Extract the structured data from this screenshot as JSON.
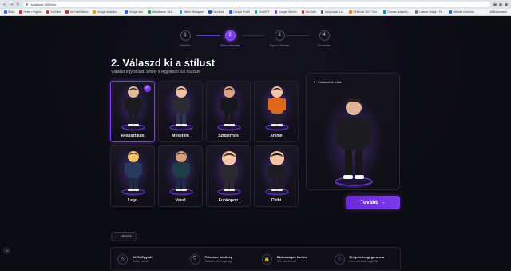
{
  "browser": {
    "url": "localhost:3000/hu",
    "bookmarks": [
      {
        "label": "Sidex",
        "color": "#2563eb"
      },
      {
        "label": "Hetek • Fog hu",
        "color": "#dc2626"
      },
      {
        "label": "YouTube",
        "color": "#dc2626"
      },
      {
        "label": "YouTube Music",
        "color": "#dc2626"
      },
      {
        "label": "Google Analytics ...",
        "color": "#f59e0b"
      },
      {
        "label": "Google Ads",
        "color": "#2563eb"
      },
      {
        "label": "Netsalesum - Kal...",
        "color": "#16a34a"
      },
      {
        "label": "Sitkert Sikkapper",
        "color": "#0ea5e9"
      },
      {
        "label": "Facebook",
        "color": "#1d4ed8"
      },
      {
        "label": "Google Profilt",
        "color": "#2563eb"
      },
      {
        "label": "ChatGPT",
        "color": "#10a37f"
      },
      {
        "label": "Google Gemini",
        "color": "#7c3aed"
      },
      {
        "label": "YouTube",
        "color": "#dc2626"
      },
      {
        "label": "Upsprovas a s...",
        "color": "#4b5563"
      },
      {
        "label": "SEMrush SEO Tool...",
        "color": "#f97316"
      },
      {
        "label": "Domain authority...",
        "color": "#0891b2"
      },
      {
        "label": "Custom Image - Fit...",
        "color": "#6b7280"
      },
      {
        "label": "Website Authority...",
        "color": "#2563eb"
      }
    ],
    "all_bookmarks": "All Bookmarks"
  },
  "steps": [
    {
      "num": "1",
      "label": "Feltöltés",
      "active": false
    },
    {
      "num": "2",
      "label": "Stílus választás",
      "active": true
    },
    {
      "num": "3",
      "label": "Figura előnézet",
      "active": false
    },
    {
      "num": "4",
      "label": "Rendelés",
      "active": false
    }
  ],
  "page": {
    "title": "2. Válaszd ki a stílust",
    "subtitle": "Válassz egy stílust, amely a legjobban illik hozzád!"
  },
  "styles": [
    {
      "name": "Realisztikus",
      "selected": true,
      "skin": "#e0b89a",
      "hair": "#2a1f1a",
      "cloth": "#1b1b1f",
      "pants": "#1b1b1f"
    },
    {
      "name": "Mesefilm",
      "selected": false,
      "skin": "#f0c2a0",
      "hair": "#3b2a20",
      "cloth": "#2b2b33",
      "pants": "#2a3550"
    },
    {
      "name": "Szuperhős",
      "selected": false,
      "skin": "#d9a584",
      "hair": "#1c1c1c",
      "cloth": "#17181c",
      "pants": "#17181c"
    },
    {
      "name": "Anime",
      "selected": false,
      "skin": "#f2c6a4",
      "hair": "#1a1a1a",
      "cloth": "#e0661c",
      "pants": "#1e1e24"
    },
    {
      "name": "Lego",
      "selected": false,
      "skin": "#f2c46b",
      "hair": "#3a2a1e",
      "cloth": "#2a3a5c",
      "pants": "#1f2a44"
    },
    {
      "name": "Voxel",
      "selected": false,
      "skin": "#d8a37c",
      "hair": "#3a2618",
      "cloth": "#1f3c46",
      "pants": "#1d2b4a"
    },
    {
      "name": "Funkopop",
      "selected": false,
      "skin": "#f4c8a8",
      "hair": "#4a3020",
      "cloth": "#2a2a30",
      "pants": "#2a2a30"
    },
    {
      "name": "Chibi",
      "selected": false,
      "skin": "#f0c4a4",
      "hair": "#231a15",
      "cloth": "#1c1c22",
      "pants": "#1c1c22"
    }
  ],
  "preview": {
    "title": "Kiválasztott stílus"
  },
  "buttons": {
    "next": "Tovább",
    "back": "Vissza"
  },
  "features": [
    {
      "icon": "◇",
      "title": "100% Egyedi",
      "sub": "Rólad, neked"
    },
    {
      "icon": "⛉",
      "title": "Prémium minőség",
      "sub": "Tartós és részletgazdag"
    },
    {
      "icon": "🔒",
      "title": "Biztonságos fizetés",
      "sub": "SSL védelemmel"
    },
    {
      "icon": "♡",
      "title": "Elégedettségi garancia",
      "sub": "Ha nem tetszik, segítünk!"
    }
  ],
  "corner_label": "N"
}
